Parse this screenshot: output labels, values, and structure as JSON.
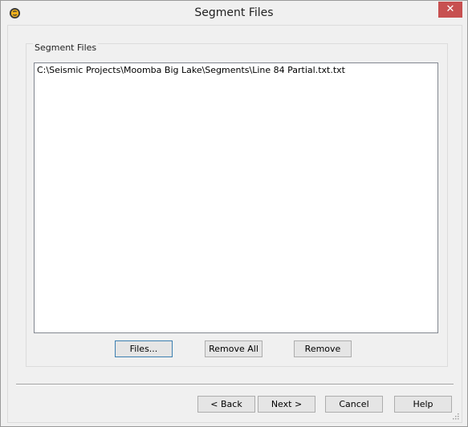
{
  "window": {
    "title": "Segment Files",
    "close_glyph": "✕",
    "accent_close": "#c75050"
  },
  "group": {
    "label": "Segment Files",
    "items": [
      "C:\\Seismic Projects\\Moomba Big Lake\\Segments\\Line 84 Partial.txt.txt"
    ]
  },
  "actions": {
    "files": "Files...",
    "remove_all": "Remove All",
    "remove": "Remove"
  },
  "footer": {
    "back": "< Back",
    "next": "Next >",
    "cancel": "Cancel",
    "help": "Help"
  },
  "icons": {
    "app": "app-logo-icon",
    "grip": "resize-grip-icon"
  }
}
